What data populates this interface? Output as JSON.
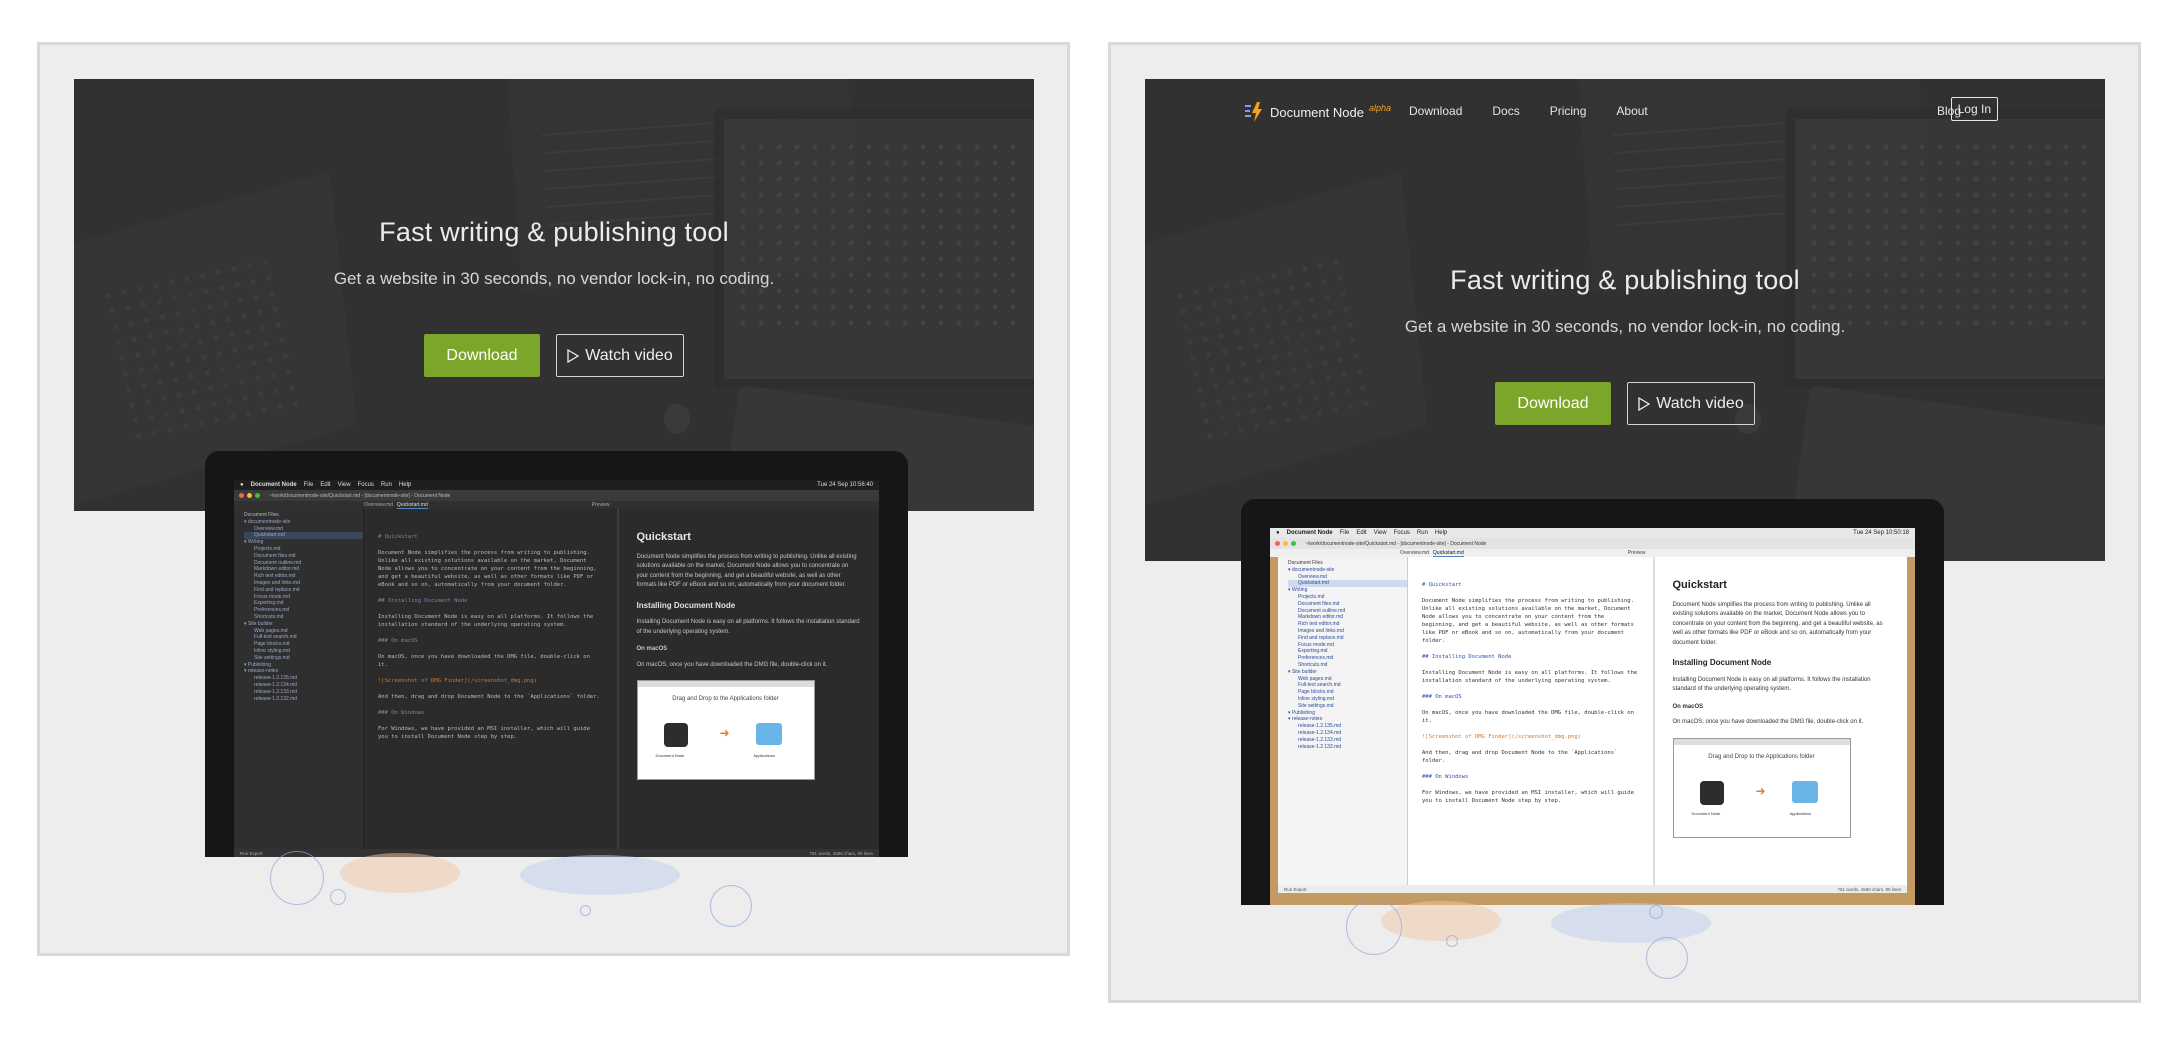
{
  "hero": {
    "title": "Fast writing & publishing tool",
    "subtitle": "Get a website in 30 seconds, no vendor lock-in, no coding.",
    "download_label": "Download",
    "watch_label": "Watch video"
  },
  "nav": {
    "logo": "Document Node",
    "alpha": "alpha",
    "links": [
      "Download",
      "Docs",
      "Pricing",
      "About"
    ],
    "blog": "Blog",
    "login": "Log In"
  },
  "app": {
    "menubar": {
      "app_name": "Document Node",
      "menus": [
        "File",
        "Edit",
        "View",
        "Focus",
        "Run",
        "Help"
      ],
      "time_left": "Tue 24 Sep  10:56:40",
      "time_right": "Tue 24 Sep  10:50:18"
    },
    "window_title": "~/work/documentnode-site/Quickstart.md - [documentnode-site] - Document Node",
    "tabs": [
      "Overview.md",
      "Quickstart.md"
    ],
    "preview_tab": "Preview",
    "sidebar_header": "Document Files",
    "tree": [
      "documentnode-site",
      "Overview.md",
      "Quickstart.md",
      "Writing",
      "Projects.md",
      "Document files.md",
      "Document outline.md",
      "Markdown editor.md",
      "Rich text editor.md",
      "Images and links.md",
      "Find and replace.md",
      "Focus mode.md",
      "Exporting.md",
      "Preferences.md",
      "Shortcuts.md",
      "Site builder",
      "Web pages.md",
      "Full-text search.md",
      "Page blocks.md",
      "Inline styling.md",
      "Site settings.md",
      "Publishing",
      "release-notes",
      "release-1.2.135.md",
      "release-1.2.134.md",
      "release-1.2.133.md",
      "release-1.2.132.md"
    ],
    "editor": {
      "heading": "# Quickstart",
      "p1": "Document Node simplifies the process from writing to publishing. Unlike all existing solutions available on the market, Document Node allows you to concentrate on your content from the beginning, and get a beautiful website, as well as other formats like PDF or eBook and so on, automatically from your document folder.",
      "h2": "## Installing Document Node",
      "p2": "Installing Document Node is easy on all platforms. It follows the installation standard of the underlying operating system.",
      "h3": "### On macOS",
      "p3": "On macOS, once you have downloaded the DMG file, double-click on it.",
      "img": "![Screenshot of DMG Finder](/screenshot_dmg.png)",
      "p4": "And then, drag and drop Document Node to the `Applications` folder.",
      "h4": "### On Windows",
      "p5": "For Windows, we have provided an MSI installer, which will guide you to install Document Node step by step."
    },
    "preview": {
      "title": "Quickstart",
      "p1": "Document Node simplifies the process from writing to publishing. Unlike all existing solutions available on the market, Document Node allows you to concentrate on your content from the beginning, and get a beautiful website, as well as other formats like PDF or eBook and so on, automatically from your document folder.",
      "h2": "Installing Document Node",
      "p2": "Installing Document Node is easy on all platforms. It follows the installation standard of the underlying operating system.",
      "h3": "On macOS",
      "p3": "On macOS, once you have downloaded the DMG file, double-click on it.",
      "dmg_caption": "Drag and Drop to the Applications folder",
      "dmg_app": "Document Node",
      "dmg_folder": "Applications"
    },
    "status": {
      "left": "Run   Export",
      "right": "751 words, 4586 chars, 80 lines"
    }
  },
  "colors": {
    "accent_green": "#7ca629",
    "logo_orange": "#f5a020"
  }
}
